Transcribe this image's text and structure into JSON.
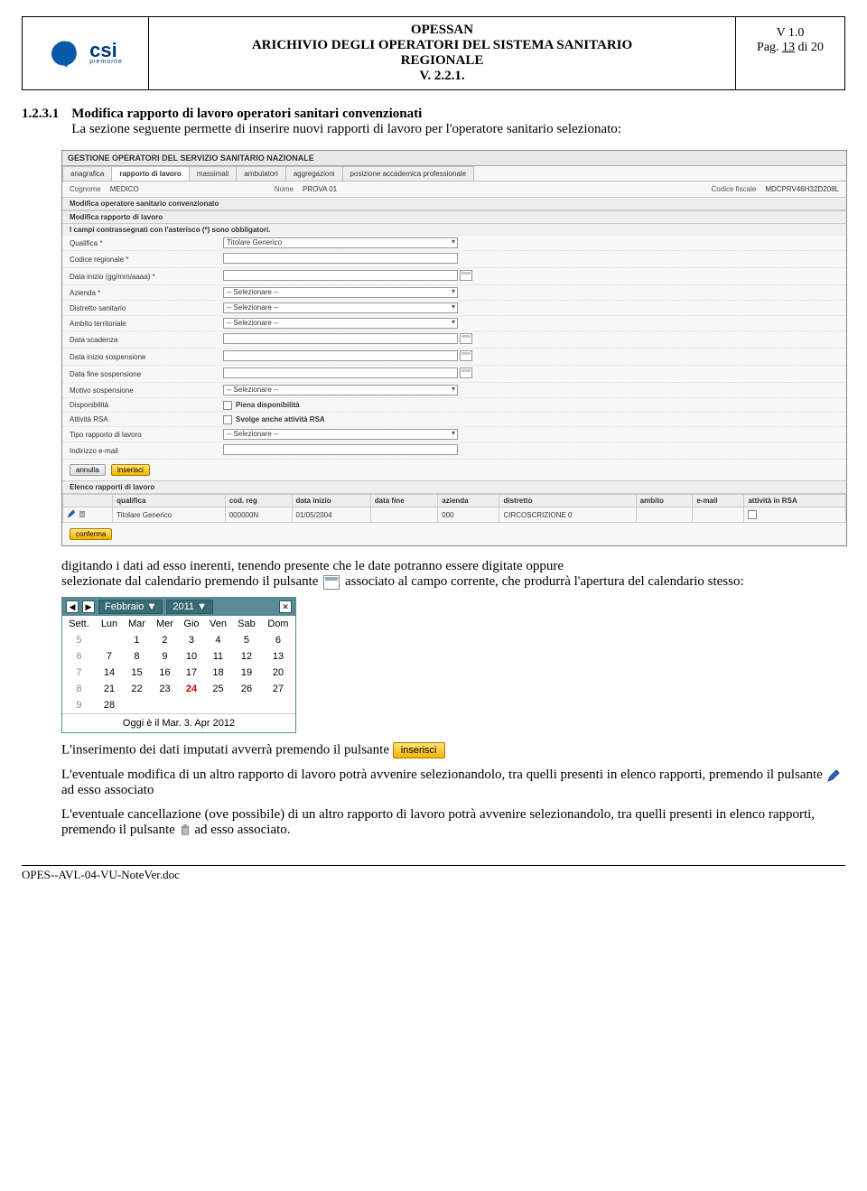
{
  "header": {
    "logo_text": "csi",
    "logo_sub": "piemonte",
    "line1": "OPESSAN",
    "line2": "ARICHIVIO DEGLI OPERATORI DEL SISTEMA SANITARIO",
    "line3": "REGIONALE",
    "line4": "V. 2.2.1.",
    "right1": "V 1.0",
    "right2_pre": "Pag. ",
    "right2_page": "13",
    "right2_post": " di 20"
  },
  "section": {
    "number": "1.2.3.1",
    "title": "Modifica rapporto di lavoro operatori sanitari convenzionati",
    "intro": "La sezione seguente permette di inserire nuovi rapporti di lavoro per l'operatore sanitario selezionato:"
  },
  "form_screenshot": {
    "frame_title": "GESTIONE OPERATORI DEL SERVIZIO SANITARIO NAZIONALE",
    "tabs": [
      "anagrafica",
      "rapporto di lavoro",
      "massimali",
      "ambulatori",
      "aggregazioni",
      "posizione accademica professionale"
    ],
    "active_tab": 1,
    "id": {
      "cognome_k": "Cognome",
      "cognome_v": "MEDICO",
      "nome_k": "Nome",
      "nome_v": "PROVA 01",
      "cf_k": "Codice fiscale",
      "cf_v": "MDCPRV46H32D208L"
    },
    "sub1": "Modifica operatore sanitario convenzionato",
    "sub2": "Modifica rapporto di lavoro",
    "mandatory_note": "I campi contrassegnati con l'asterisco (*) sono obbligatori.",
    "rows": [
      {
        "label": "Qualifica *",
        "type": "select",
        "value": "Titolare Generico"
      },
      {
        "label": "Codice regionale *",
        "type": "input"
      },
      {
        "label": "Data inizio (gg/mm/aaaa) *",
        "type": "date"
      },
      {
        "label": "Azienda *",
        "type": "select",
        "value": "-- Selezionare --"
      },
      {
        "label": "Distretto sanitario",
        "type": "select",
        "value": "-- Selezionare --"
      },
      {
        "label": "Ambito territoriale",
        "type": "select",
        "value": "-- Selezionare --"
      },
      {
        "label": "Data scadenza",
        "type": "date"
      },
      {
        "label": "Data inizio sospensione",
        "type": "date"
      },
      {
        "label": "Data fine sospensione",
        "type": "date"
      },
      {
        "label": "Motivo sospensione",
        "type": "select",
        "value": "-- Selezionare --"
      },
      {
        "label": "Disponibilità",
        "type": "check",
        "value": "Piena disponibilità"
      },
      {
        "label": "Attività RSA",
        "type": "check",
        "value": "Svolge anche attività RSA"
      },
      {
        "label": "Tipo rapporto di lavoro",
        "type": "select",
        "value": "-- Selezionare --"
      },
      {
        "label": "Indirizzo e-mail",
        "type": "input"
      }
    ],
    "btn_annulla": "annulla",
    "btn_inserisci": "inserisci",
    "elenco_title": "Elenco rapporti di lavoro",
    "table": {
      "headers": [
        "",
        "qualifica",
        "cod. reg",
        "data inizio",
        "data fine",
        "azienda",
        "distretto",
        "ambito",
        "e-mail",
        "attività in RSA"
      ],
      "row": [
        "",
        "Titolare Generico",
        "000000N",
        "01/05/2004",
        "",
        "000",
        "CIRCOSCRIZIONE 0",
        "",
        "",
        ""
      ]
    },
    "btn_conferma": "conferma"
  },
  "para1_a": "digitando i dati ad esso inerenti, tenendo presente che le date potranno essere digitate oppure",
  "para1_b": "selezionate dal calendario premendo il pulsante ",
  "para1_c": " associato  al campo corrente, che produrrà l'apertura del calendario stesso:",
  "calendar": {
    "month": "Febbraio",
    "year": "2011",
    "dow": [
      "Sett.",
      "Lun",
      "Mar",
      "Mer",
      "Gio",
      "Ven",
      "Sab",
      "Dom"
    ],
    "rows": [
      [
        "5",
        "",
        "1",
        "2",
        "3",
        "4",
        "5",
        "6"
      ],
      [
        "6",
        "7",
        "8",
        "9",
        "10",
        "11",
        "12",
        "13"
      ],
      [
        "7",
        "14",
        "15",
        "16",
        "17",
        "18",
        "19",
        "20"
      ],
      [
        "8",
        "21",
        "22",
        "23",
        "24",
        "25",
        "26",
        "27"
      ],
      [
        "9",
        "28",
        "",
        "",
        "",
        "",
        "",
        ""
      ]
    ],
    "today_cell": "24",
    "footer": "Oggi è il Mar. 3. Apr 2012"
  },
  "para2": "L'inserimento dei dati imputati avverrà premendo il pulsante ",
  "btn_inserisci_label": "inserisci",
  "para3_a": "L'eventuale modifica di un altro rapporto di lavoro potrà avvenire selezionandolo, tra quelli presenti in elenco rapporti, premendo il pulsante ",
  "para3_b": " ad esso associato",
  "para4_a": "L'eventuale cancellazione (ove possibile) di un altro rapporto di lavoro potrà avvenire selezionandolo, tra quelli presenti in elenco rapporti, premendo il pulsante ",
  "para4_b": " ad esso associato.",
  "footer_doc": "OPES--AVL-04-VU-NoteVer.doc"
}
